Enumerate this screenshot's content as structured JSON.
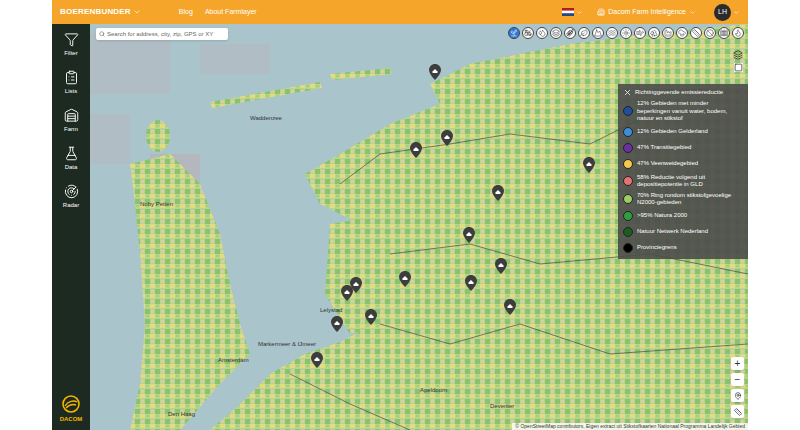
{
  "header": {
    "logo": "BOERENBUNDER",
    "nav": [
      "Blog",
      "About Farmlayer"
    ],
    "workspace": "Dacom Farm Intelligence",
    "avatar": "LH"
  },
  "sidebar": {
    "items": [
      {
        "label": "Filter"
      },
      {
        "label": "Lists"
      },
      {
        "label": "Farm"
      },
      {
        "label": "Data"
      },
      {
        "label": "Radar"
      }
    ],
    "brand": "DACOM"
  },
  "search": {
    "placeholder": "Search for address, city, zip, GPS or XY"
  },
  "map_tools": [
    {
      "selected": true
    },
    {
      "selected": false
    },
    {
      "selected": false
    },
    {
      "selected": false
    },
    {
      "selected": false
    },
    {
      "selected": false
    },
    {
      "selected": false
    },
    {
      "selected": false
    },
    {
      "selected": false
    },
    {
      "selected": false
    },
    {
      "selected": false
    },
    {
      "selected": false
    },
    {
      "selected": false
    },
    {
      "selected": false
    },
    {
      "selected": false
    },
    {
      "selected": false
    },
    {
      "selected": false
    }
  ],
  "legend": {
    "title": "Richtinggevende emissiereductie",
    "entries": [
      {
        "label": "12% Gebieden met minder beperkingen vanuit water, bodem, natuur en stikstof",
        "color": "#1f4e9c"
      },
      {
        "label": "12% Gebieden Gelderland",
        "color": "#3b8fd6"
      },
      {
        "label": "47% Transitiegebied",
        "color": "#6b2fa0"
      },
      {
        "label": "47% Veenweidegebied",
        "color": "#f2c94c"
      },
      {
        "label": "58% Reductie volgend uit depositiepotentie in GLD",
        "color": "#e57373"
      },
      {
        "label": "70% Ring rondom stikstofgevoelige N2000-gebieden",
        "color": "#9ccc65"
      },
      {
        "label": ">95% Natura 2000",
        "color": "#2e9e3f"
      },
      {
        "label": "Natuur Netwerk Nederland",
        "color": "#1b5e20"
      },
      {
        "label": "Provinciegrens",
        "color": "#000000"
      }
    ]
  },
  "map_labels": [
    "Waddenzee",
    "Noby Petten",
    "Lelystad",
    "Markermeer & IJmeer",
    "Amsterdam",
    "Apeldoorn",
    "Deventer",
    "Den Haag"
  ],
  "zoom": {
    "in": "+",
    "out": "−"
  },
  "attribution": "© OpenStreetMap contributors, Eigen extract uit Stikstofkaarten Nationaal Programma Landelijk Gebied"
}
